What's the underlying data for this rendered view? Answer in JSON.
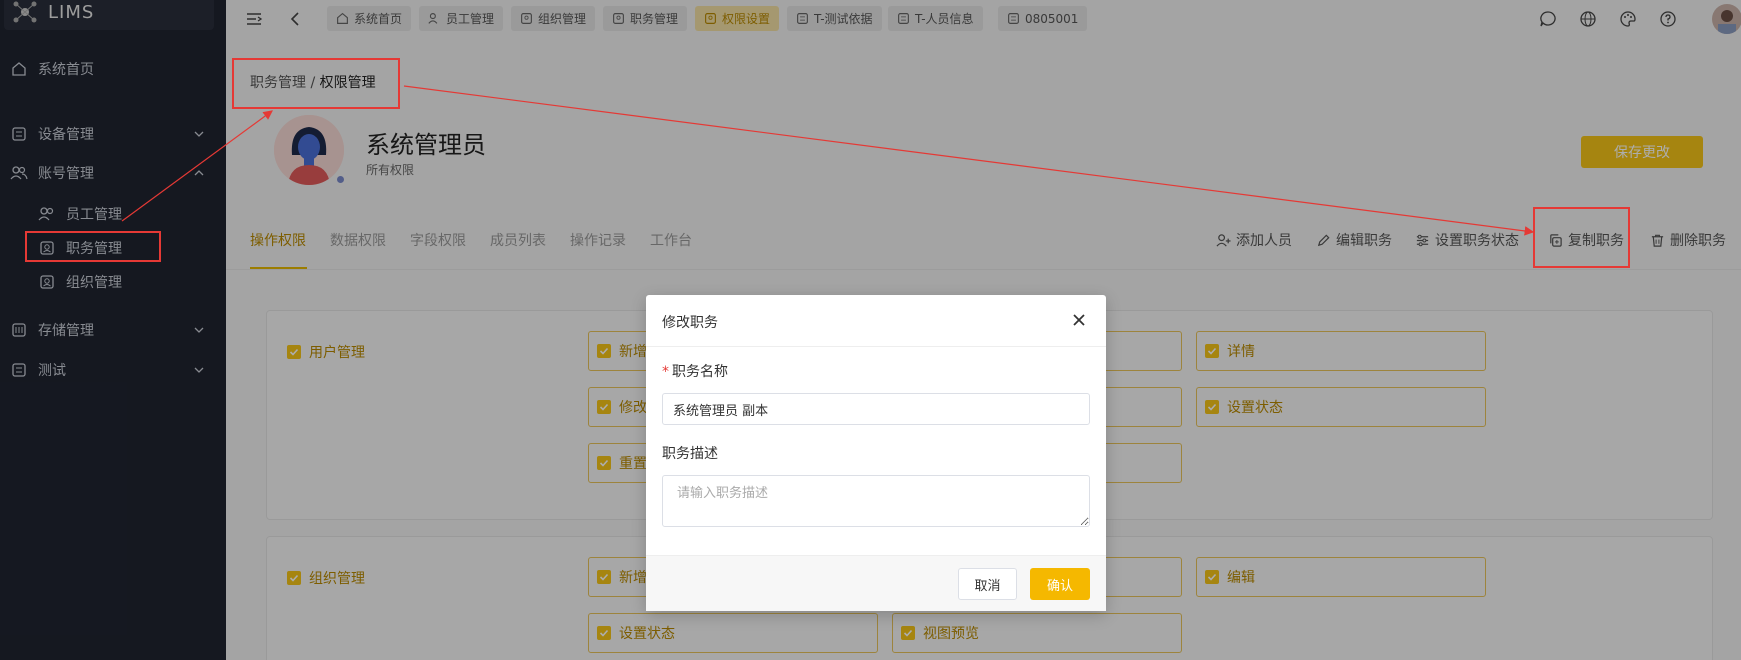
{
  "app": {
    "name": "LIMS"
  },
  "sidebar": {
    "items": [
      {
        "label": "系统首页",
        "icon": "home-icon"
      },
      {
        "label": "设备管理",
        "icon": "grid-icon"
      },
      {
        "label": "账号管理",
        "icon": "users-icon"
      },
      {
        "label": "员工管理",
        "icon": "users-icon"
      },
      {
        "label": "职务管理",
        "icon": "badge-icon"
      },
      {
        "label": "组织管理",
        "icon": "badge-icon"
      },
      {
        "label": "存储管理",
        "icon": "storage-icon"
      },
      {
        "label": "测试",
        "icon": "grid-icon"
      }
    ]
  },
  "topbar": {
    "tabs": [
      {
        "label": "系统首页",
        "icon": "home-icon"
      },
      {
        "label": "员工管理",
        "icon": "users-icon"
      },
      {
        "label": "组织管理",
        "icon": "badge-icon"
      },
      {
        "label": "职务管理",
        "icon": "badge-icon"
      },
      {
        "label": "权限设置",
        "icon": "badge-icon",
        "active": true
      },
      {
        "label": "T-测试依据",
        "icon": "grid-icon"
      },
      {
        "label": "T-人员信息",
        "icon": "grid-icon"
      },
      {
        "label": "0805001",
        "icon": "grid-icon"
      }
    ]
  },
  "breadcrumb": {
    "parent": "职务管理",
    "separator": " / ",
    "current": "权限管理"
  },
  "role": {
    "title": "系统管理员",
    "subtitle": "所有权限"
  },
  "save_button": "保存更改",
  "content_tabs": [
    "操作权限",
    "数据权限",
    "字段权限",
    "成员列表",
    "操作记录",
    "工作台"
  ],
  "actions": [
    "添加人员",
    "编辑职务",
    "设置职务状态",
    "复制职务",
    "删除职务"
  ],
  "panels": [
    {
      "label": "用户管理",
      "perms": [
        "新增",
        "详情",
        "修改",
        "设置状态",
        "重置"
      ]
    },
    {
      "label": "组织管理",
      "perms": [
        "新增",
        "编辑",
        "设置状态",
        "视图预览"
      ]
    }
  ],
  "dialog": {
    "title": "修改职务",
    "name_label": "职务名称",
    "name_value": "系统管理员 副本",
    "desc_label": "职务描述",
    "desc_placeholder": "请输入职务描述",
    "cancel": "取消",
    "confirm": "确认"
  },
  "colors": {
    "accent": "#f5c518",
    "annotation": "#e53935",
    "sidebar_bg": "#1f2430"
  }
}
